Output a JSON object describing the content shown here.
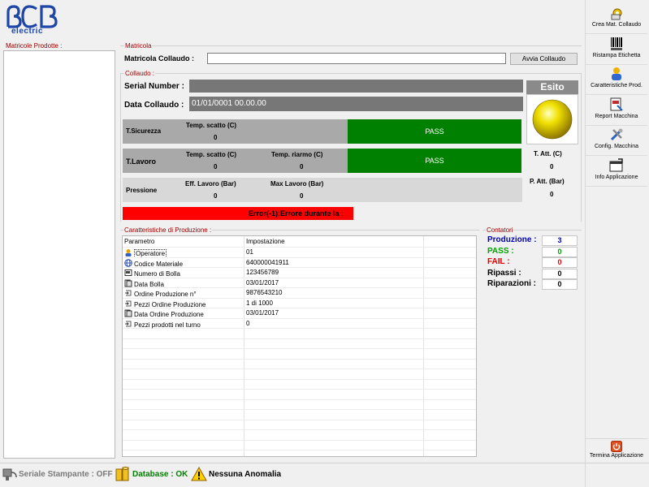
{
  "brand": {
    "logo_text": "ACB",
    "sub": "electric",
    "color": "#1e46a8"
  },
  "left_panel": {
    "title": "Matricole Prodotte :"
  },
  "matricola": {
    "group_title": "Matricola",
    "label": "Matricola Collaudo :",
    "value": "",
    "button": "Avvia Collaudo"
  },
  "collaudo": {
    "group_title": "Collaudo :",
    "serial_label": "Serial Number :",
    "serial_value": "",
    "date_label": "Data Collaudo :",
    "date_value": "01/01/0001 00.00.00",
    "sicurezza": {
      "label": "T.Sicurezza",
      "temp_label": "Temp. scatto (C)",
      "temp_value": "0",
      "result": "PASS"
    },
    "lavoro": {
      "label": "T.Lavoro",
      "temp_label": "Temp. scatto (C)",
      "temp_value": "0",
      "riarmo_label": "Temp. riarmo (C)",
      "riarmo_value": "0",
      "result": "PASS"
    },
    "pressione": {
      "label": "Pressione",
      "eff_label": "Eff. Lavoro (Bar)",
      "eff_value": "0",
      "max_label": "Max Lavoro (Bar)",
      "max_value": "0"
    },
    "error_text": "Error(-1):Errore durante la :",
    "esito_label": "Esito",
    "t_att_label": "T. Att. (C)",
    "t_att_value": "0",
    "p_att_label": "P. Att. (Bar)",
    "p_att_value": "0"
  },
  "caratteristiche": {
    "group_title": "Caratteristiche di Produzione :",
    "headers": [
      "Parametro",
      "Impostazione"
    ],
    "rows": [
      {
        "icon": "user-icon",
        "param": "Operatore",
        "value": "01"
      },
      {
        "icon": "globe-icon",
        "param": "Codice Materiale",
        "value": "640000041911"
      },
      {
        "icon": "document-icon",
        "param": "Numero di Bolla",
        "value": "123456789"
      },
      {
        "icon": "calendar-icon",
        "param": "Data Bolla",
        "value": "03/01/2017"
      },
      {
        "icon": "order-icon",
        "param": "Ordine Produzione n°",
        "value": "9876543210"
      },
      {
        "icon": "order-icon",
        "param": "Pezzi Ordine Produzione",
        "value": "1 di 1000"
      },
      {
        "icon": "calendar-icon",
        "param": "Data Ordine Produzione",
        "value": "03/01/2017"
      },
      {
        "icon": "order-icon",
        "param": "Pezzi prodotti nel turno",
        "value": "0"
      }
    ]
  },
  "contatori": {
    "group_title": "Contatori",
    "items": [
      {
        "label": "Produzione :",
        "value": "3",
        "color": "#0000c0"
      },
      {
        "label": "PASS :",
        "value": "0",
        "color": "#00a000"
      },
      {
        "label": "FAIL :",
        "value": "0",
        "color": "#e00000"
      },
      {
        "label": "Ripassi :",
        "value": "0",
        "color": "#000000"
      },
      {
        "label": "Riparazioni :",
        "value": "0",
        "color": "#000000"
      }
    ]
  },
  "toolbar": {
    "items": [
      {
        "label": "Crea Mat. Collaudo",
        "icon": "gear-icon"
      },
      {
        "label": "Ristampa Etichetta",
        "icon": "barcode-icon"
      },
      {
        "label": "Caratteristiche Prod.",
        "icon": "user-icon"
      },
      {
        "label": "Report Macchina",
        "icon": "report-icon"
      },
      {
        "label": "Config. Macchina",
        "icon": "tools-icon"
      },
      {
        "label": "Info Applicazione",
        "icon": "info-icon"
      }
    ],
    "exit": {
      "label": "Termina Applicazione",
      "icon": "power-icon"
    }
  },
  "status": {
    "printer": "Seriale Stampante : OFF",
    "database": "Database : OK",
    "anomaly": "Nessuna Anomalia",
    "colors": {
      "printer": "#7a7a7a",
      "database": "#008000",
      "anomaly": "#000000"
    }
  }
}
